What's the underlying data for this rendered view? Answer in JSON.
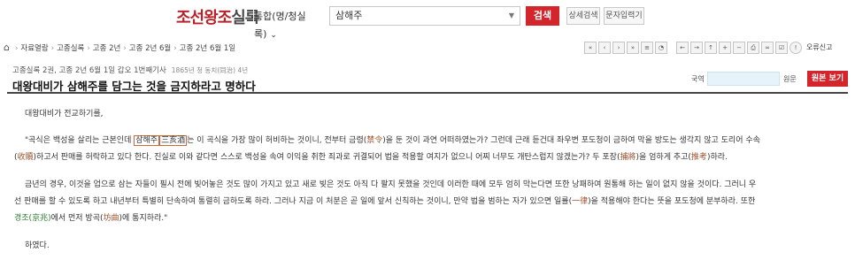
{
  "header": {
    "logo_a": "조선왕조",
    "logo_b": "실록",
    "search_scope": "통합(명/청실록)",
    "search_query": "삼해주",
    "search_button": "검색",
    "detail_search": "상세검색",
    "char_input": "문자입력기"
  },
  "breadcrumb": [
    "자료열람",
    "고종실록",
    "고종 2년",
    "고종 2년 6월",
    "고종 2년 6월 1일"
  ],
  "toolbar": {
    "report": "오류신고"
  },
  "article": {
    "meta": "고종실록 2권, 고종 2년 6월 1일 갑오 1번째기사",
    "meta_sub": "1865년 청 동치(同治) 4년",
    "title": "대왕대비가 삼해주를 담그는 것을 금지하라고 명하다",
    "lang_label": "국역",
    "orig_label": "원문",
    "orig_button": "원본 보기"
  },
  "body": {
    "p1": "대왕대비가 전교하기를,",
    "p2_a": "\"곡식은 백성을 살리는 근본인데 ",
    "p2_hl1": "삼해주",
    "p2_hl2": "三亥酒",
    "p2_b": "는 이 곡식을 가장 많이 허비하는 것이니, 전부터 금령(",
    "p2_ban": "禁令",
    "p2_c": ")을 둔 것이 과연 어떠하였는가? 그런데 근래 듣건대 좌우변 포도청이 금하여 막을 방도는 생각지 않고 도리어 수속",
    "p2_d": "(",
    "p2_sufe": "收贖",
    "p2_e": ")하고서 판매를 허락하고 있다 한다. 진실로 이와 같다면 스스로 백성을 속여 이익을 취한 죄과로 귀결되어 법을 적용할 여지가 없으니 어찌 너무도 개탄스럽지 않겠는가? 두 포장(",
    "p2_pojang": "捕將",
    "p2_f": ")을 엄하게 추고(",
    "p2_chugo": "推考",
    "p2_g": ")하라.",
    "p3_a": "금년의 경우, 이것을 업으로 삼는 자들이 필시 전에 빚어놓은 것도 많이 가지고 있고 새로 빚은 것도 아직 다 팔지 못했을 것인데 이러한 때에 모두 엄히 막는다면 또한 낭패하여 원통해 하는 일이 없지 않을 것이다. 그러니 우",
    "p3_b": "선 판매를 할 수 있도록 하고 내년부터 특별히 단속하여 통렬히 금하도록 하라. 그러나 지금 이 처분은 곧 일에 앞서 신칙하는 것이니, 만약 법을 범하는 자가 있으면 일률(",
    "p3_ilyul": "一律",
    "p3_c": ")을 적용해야 한다는 뜻을 포도청에 분부하라. 또한",
    "p3_kyeongjo": "경조(京兆)",
    "p3_d": "에서 먼저 방곡(",
    "p3_banggok": "坊曲",
    "p3_e": ")에 통지하라.\"",
    "p4": "하였다."
  },
  "colors": {
    "accent": "#d2252c",
    "link_brown": "#a0522d",
    "link_green": "#2e7d32"
  }
}
